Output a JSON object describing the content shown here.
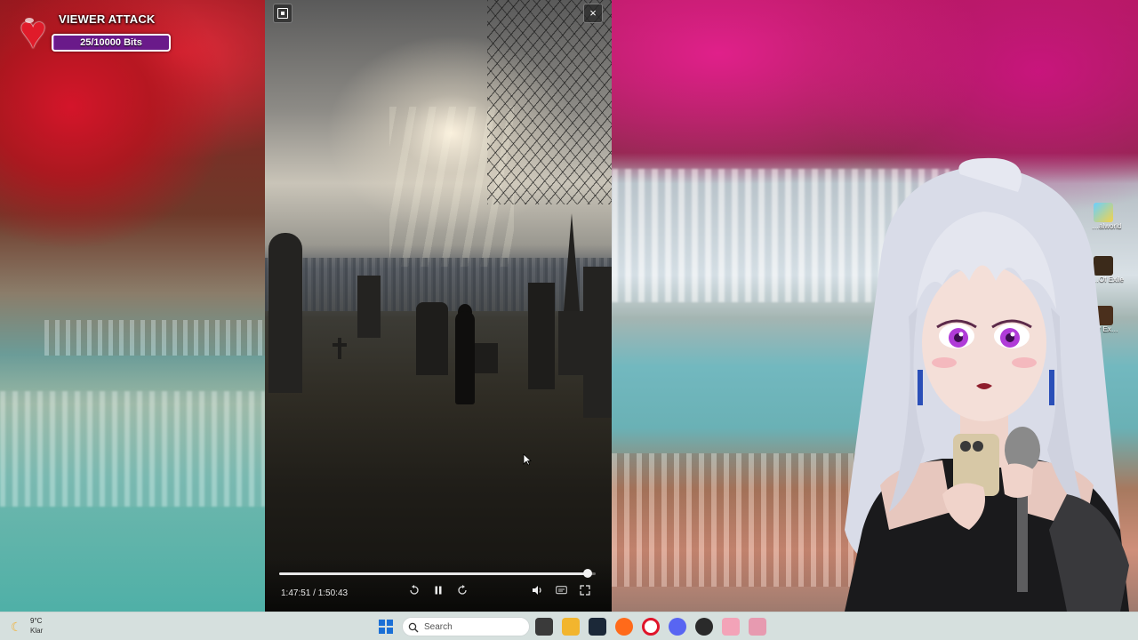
{
  "overlay": {
    "title": "VIEWER ATTACK",
    "progress_text": "25/10000 Bits",
    "progress_fraction": 0.0025
  },
  "player": {
    "time_text": "1:47:51 / 1:50:43",
    "progress_fraction": 0.974,
    "close_icon": "×"
  },
  "desktop": {
    "icons": [
      {
        "label": "…alworld"
      },
      {
        "label": "…Of Exile"
      },
      {
        "label": "…f Ex…"
      }
    ]
  },
  "taskbar": {
    "weather_temp": "9°C",
    "weather_condition": "Klar",
    "search_placeholder": "Search",
    "apps": [
      {
        "name": "task-view-app-icon",
        "color": "#3a3a3a"
      },
      {
        "name": "file-explorer-app-icon",
        "color": "#f2b52e"
      },
      {
        "name": "steam-app-icon",
        "color": "#1b2838"
      },
      {
        "name": "firefox-app-icon",
        "color": "#ff6a1a"
      },
      {
        "name": "opera-app-icon",
        "color": "#e0142a"
      },
      {
        "name": "discord-app-icon",
        "color": "#5865f2"
      },
      {
        "name": "obs-app-icon",
        "color": "#2a2a2a"
      },
      {
        "name": "heart-app-icon",
        "color": "#f3a3b8"
      },
      {
        "name": "pink-app-icon",
        "color": "#e79ab0"
      }
    ]
  },
  "colors": {
    "accent_purple": "#a34fd0",
    "heart_red": "#e01b2a",
    "windows_blue": "#1a6fd6"
  }
}
